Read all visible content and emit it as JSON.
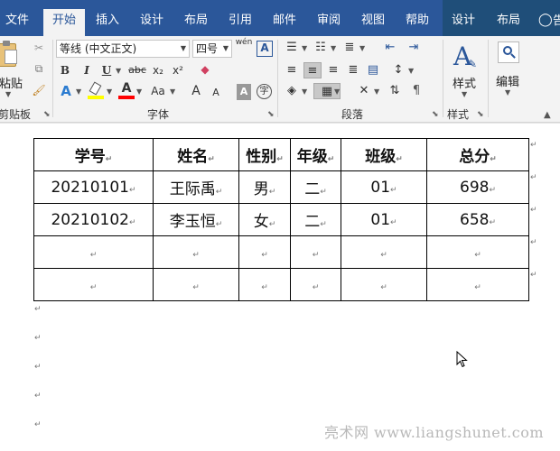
{
  "menu": {
    "tabs": [
      "文件",
      "开始",
      "插入",
      "设计",
      "布局",
      "引用",
      "邮件",
      "审阅",
      "视图",
      "帮助",
      "设计",
      "布局"
    ],
    "active_index": 1,
    "tell_me_partial": "告"
  },
  "ribbon": {
    "clipboard": {
      "paste_label": "粘贴",
      "group_label": "剪贴板"
    },
    "font": {
      "font_name": "等线 (中文正文)",
      "font_size": "四号",
      "phonetic_label": "wén",
      "charborder_label": "A",
      "bold": "B",
      "italic": "I",
      "underline": "U",
      "strike": "abc",
      "subscript": "x₂",
      "superscript": "x²",
      "change_case": "Aa",
      "grow": "A",
      "shrink": "A",
      "char_shading": "A",
      "enclose_char": "字",
      "group_label": "字体"
    },
    "paragraph": {
      "group_label": "段落"
    },
    "styles": {
      "label": "样式",
      "group_label": "样式"
    },
    "editing": {
      "label": "编辑"
    },
    "colors": {
      "highlight": "#ffff00",
      "font_color": "#ff0000",
      "accent": "#2b579a"
    }
  },
  "table": {
    "headers": [
      "学号",
      "姓名",
      "性别",
      "年级",
      "班级",
      "总分"
    ],
    "rows": [
      [
        "20210101",
        "王际禹",
        "男",
        "二",
        "01",
        "698"
      ],
      [
        "20210102",
        "李玉恒",
        "女",
        "二",
        "01",
        "658"
      ],
      [
        "",
        "",
        "",
        "",
        "",
        ""
      ],
      [
        "",
        "",
        "",
        "",
        "",
        ""
      ]
    ]
  },
  "paragraph_mark": "↵",
  "watermark": "亮术网 www.liangshunet.com"
}
